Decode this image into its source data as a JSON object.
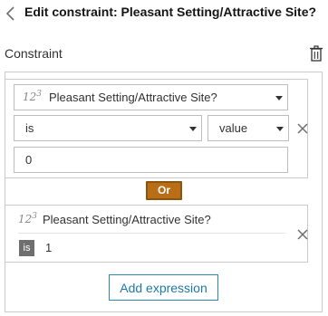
{
  "header": {
    "title": "Edit constraint: Pleasant Setting/Attractive Site?"
  },
  "constraint": {
    "section_label": "Constraint",
    "expression1": {
      "field_icon": "number-field-icon",
      "field_icon_base": "12",
      "field_icon_sup": "3",
      "field": "Pleasant Setting/Attractive Site?",
      "operator": "is",
      "value_type": "value",
      "value": "0"
    },
    "or_label": "Or",
    "expression2": {
      "field_icon_base": "12",
      "field_icon_sup": "3",
      "field": "Pleasant Setting/Attractive Site?",
      "operator_badge": "is",
      "value": "1"
    },
    "add_expression_label": "Add expression"
  },
  "colors": {
    "accent_or": "#b96e16",
    "link_blue": "#1e7aa0",
    "border": "#cacaca",
    "badge_gray": "#6e6e6e"
  }
}
